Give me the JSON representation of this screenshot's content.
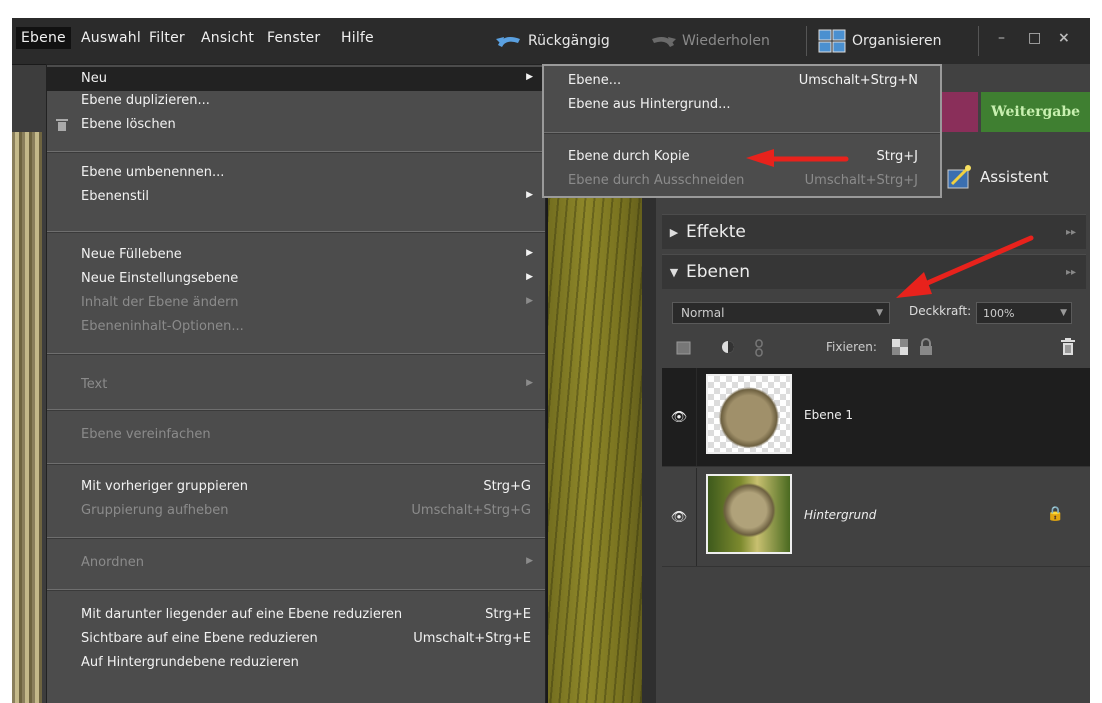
{
  "menubar": {
    "items": [
      "Ebene",
      "Auswahl",
      "Filter",
      "Ansicht",
      "Fenster",
      "Hilfe"
    ],
    "undo": "Rückgängig",
    "redo": "Wiederholen",
    "organize": "Organisieren",
    "window_min": "–",
    "window_max": "□",
    "window_close": "×"
  },
  "menu": {
    "items": [
      {
        "label": "Neu",
        "submenu": "▶"
      },
      {
        "label": "Ebene duplizieren..."
      },
      {
        "label": "Ebene löschen"
      },
      {
        "label": "Ebene umbenennen..."
      },
      {
        "label": "Ebenenstil",
        "submenu": "▶"
      },
      {
        "label": "Neue Füllebene",
        "submenu": "▶"
      },
      {
        "label": "Neue Einstellungsebene",
        "submenu": "▶"
      },
      {
        "label": "Inhalt der Ebene ändern",
        "submenu": "▶"
      },
      {
        "label": "Ebeneninhalt-Optionen..."
      },
      {
        "label": "Text",
        "submenu": "▶"
      },
      {
        "label": "Ebene vereinfachen"
      },
      {
        "label": "Mit vorheriger gruppieren",
        "shortcut": "Strg+G"
      },
      {
        "label": "Gruppierung aufheben",
        "shortcut": "Umschalt+Strg+G"
      },
      {
        "label": "Anordnen",
        "submenu": "▶"
      },
      {
        "label": "Mit darunter liegender auf eine Ebene reduzieren",
        "shortcut": "Strg+E"
      },
      {
        "label": "Sichtbare auf eine Ebene reduzieren",
        "shortcut": "Umschalt+Strg+E"
      },
      {
        "label": "Auf Hintergrundebene reduzieren"
      }
    ]
  },
  "submenu": {
    "items": [
      {
        "label": "Ebene...",
        "shortcut": "Umschalt+Strg+N"
      },
      {
        "label": "Ebene aus Hintergrund..."
      },
      {
        "label": "Ebene durch Kopie",
        "shortcut": "Strg+J"
      },
      {
        "label": "Ebene durch Ausschneiden",
        "shortcut": "Umschalt+Strg+J"
      }
    ]
  },
  "panel": {
    "share_tab": "Weitergabe",
    "assistant": "Assistent",
    "effects": "Effekte",
    "layers": "Ebenen",
    "collapse_glyph": "▸▸",
    "blend_mode": "Normal",
    "opacity_label": "Deckkraft:",
    "opacity_value": "100%",
    "fix_label": "Fixieren:",
    "layers_list": [
      {
        "name": "Ebene 1"
      },
      {
        "name": "Hintergrund"
      }
    ]
  },
  "colors": {
    "menu_bg": "#4c4c4c",
    "highlight": "#222222",
    "share_green": "#3f7f31",
    "arrow_red": "#e8221c"
  }
}
